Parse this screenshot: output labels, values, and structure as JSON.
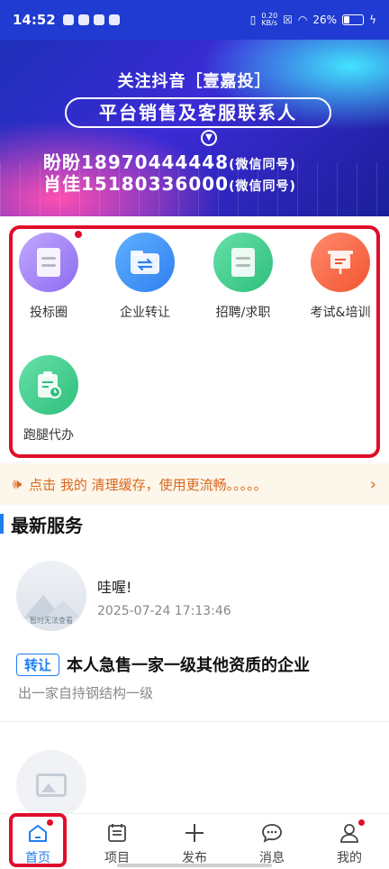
{
  "status_bar": {
    "time": "14:52",
    "net_speed_top": "0.20",
    "net_speed_bottom": "KB/s",
    "battery": "26%"
  },
  "banner": {
    "line1": "关注抖音［壹嘉投］",
    "line2": "平台销售及客服联系人",
    "contact1": "盼盼18970444448",
    "contact1_note": "(微信同号)",
    "contact2": "肖佳15180336000",
    "contact2_note": "(微信同号)"
  },
  "services": [
    {
      "label": "投标圈",
      "icon": "document-icon",
      "color": "#a78bfa"
    },
    {
      "label": "企业转让",
      "icon": "transfer-folder-icon",
      "color": "#3b8cf5"
    },
    {
      "label": "招聘/求职",
      "icon": "document-list-icon",
      "color": "#3fcf8e"
    },
    {
      "label": "考试&培训",
      "icon": "presentation-board-icon",
      "color": "#fb6b4e"
    },
    {
      "label": "跑腿代办",
      "icon": "clipboard-clock-icon",
      "color": "#3fcf8e"
    }
  ],
  "notice": {
    "text": "点击 我的 清理缓存，使用更流畅。。。。。",
    "color": "#d9681c"
  },
  "latest": {
    "title": "最新服务",
    "post": {
      "avatar_caption": "暂时无法查看",
      "name": "哇喔!",
      "time": "2025-07-24 17:13:46",
      "tag": "转让",
      "title": "本人急售一家一级其他资质的企业",
      "desc": "出一家自持钢结构一级"
    }
  },
  "tabbar": {
    "items": [
      {
        "label": "首页",
        "icon": "home-icon"
      },
      {
        "label": "项目",
        "icon": "list-icon"
      },
      {
        "label": "发布",
        "icon": "plus-icon"
      },
      {
        "label": "消息",
        "icon": "chat-icon"
      },
      {
        "label": "我的",
        "icon": "user-icon"
      }
    ],
    "active_color": "#1f7ef0",
    "highlight_color": "#e00d2a"
  }
}
